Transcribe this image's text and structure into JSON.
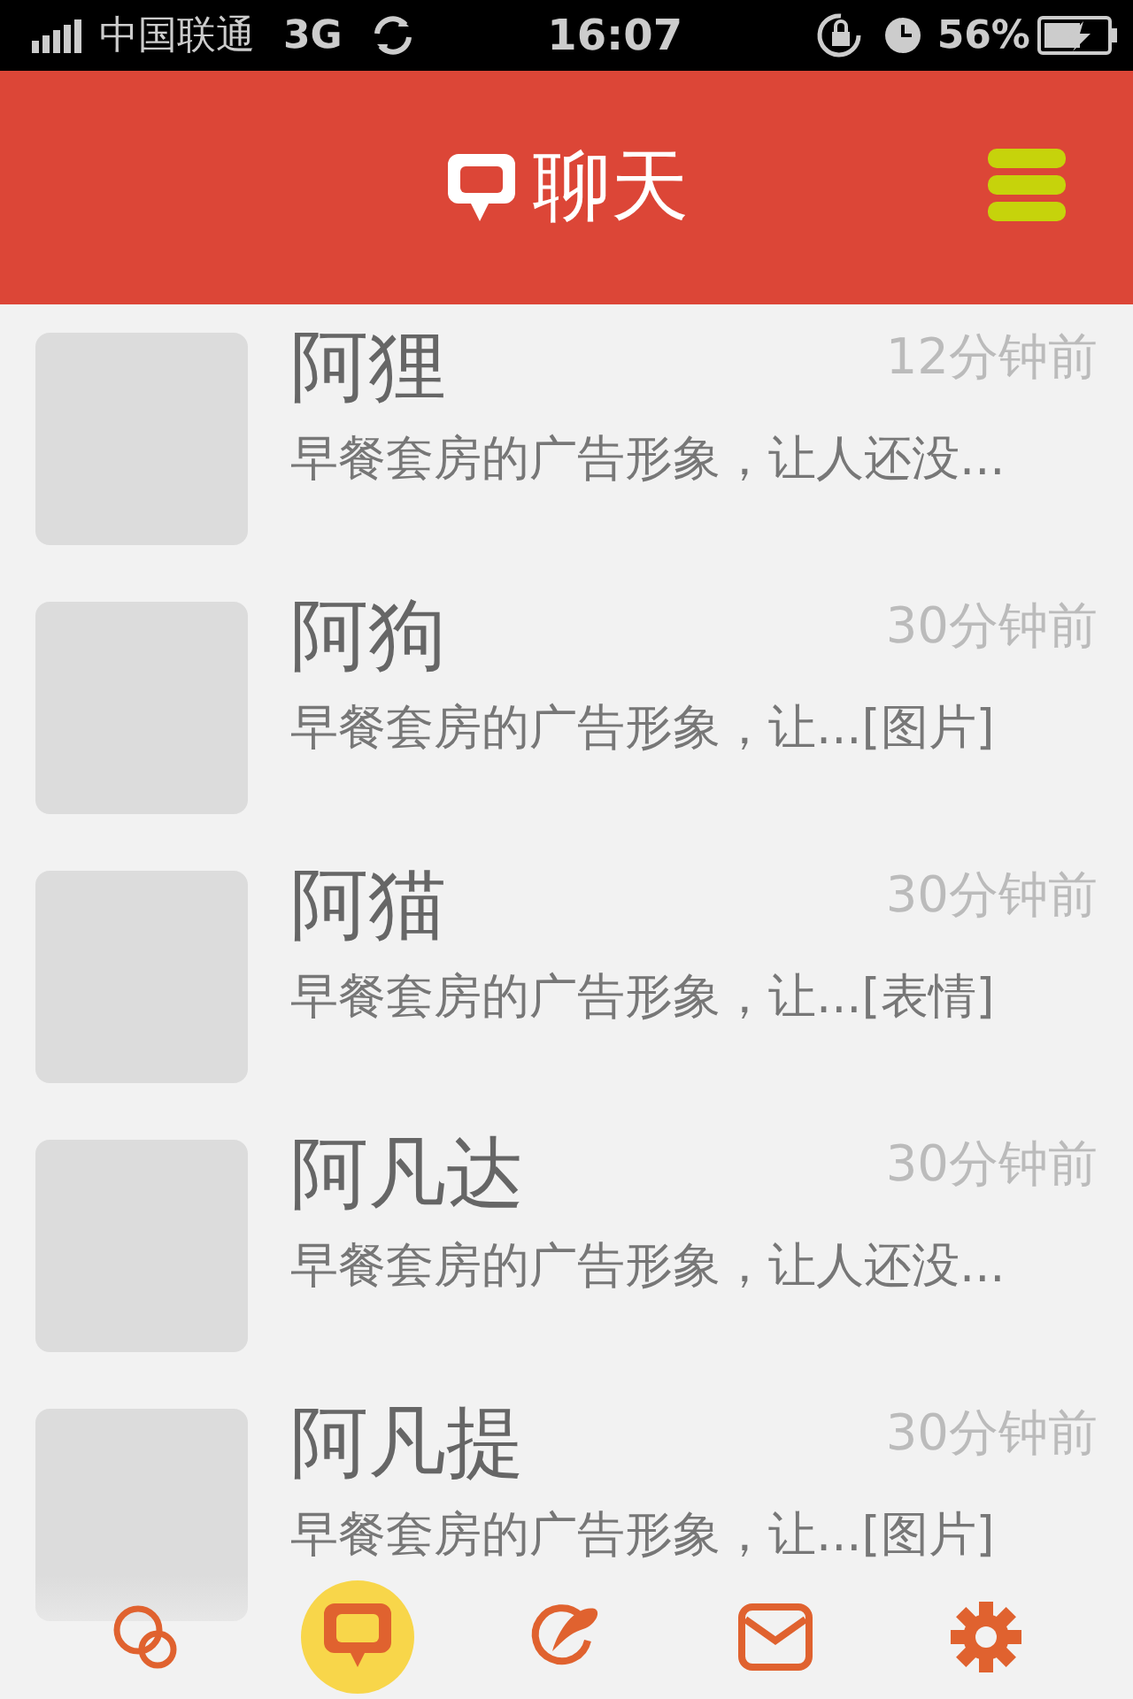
{
  "status_bar": {
    "carrier": "中国联通",
    "network": "3G",
    "time": "16:07",
    "battery": "56%"
  },
  "header": {
    "title": "聊天"
  },
  "chats": [
    {
      "name": "阿狸",
      "time": "12分钟前",
      "preview": "早餐套房的广告形象，让人还没..."
    },
    {
      "name": "阿狗",
      "time": "30分钟前",
      "preview": "早餐套房的广告形象，让...[图片]"
    },
    {
      "name": "阿猫",
      "time": "30分钟前",
      "preview": "早餐套房的广告形象，让...[表情]"
    },
    {
      "name": "阿凡达",
      "time": "30分钟前",
      "preview": "早餐套房的广告形象，让人还没..."
    },
    {
      "name": "阿凡提",
      "time": "30分钟前",
      "preview": "早餐套房的广告形象，让...[图片]"
    }
  ],
  "tab_bar": [
    {
      "kind": "circles",
      "selected": false
    },
    {
      "kind": "chat",
      "selected": true
    },
    {
      "kind": "feather",
      "selected": false
    },
    {
      "kind": "mail",
      "selected": false
    },
    {
      "kind": "gear",
      "selected": false
    }
  ]
}
